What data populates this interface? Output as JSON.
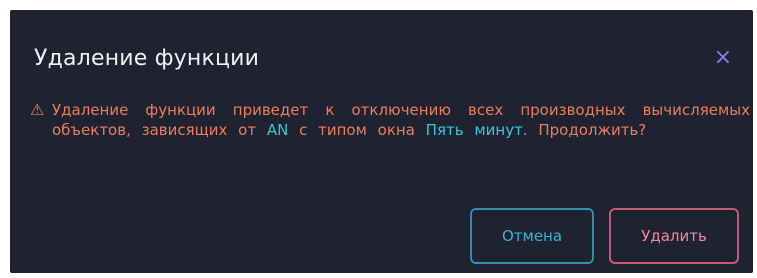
{
  "dialog": {
    "title": "Удаление функции",
    "close_icon": "×",
    "warning_icon": "⚠",
    "message_part1": "Удаление функции приведет к отключению всех производных вычисляемых объектов, зависящих от ",
    "object_name": "AN",
    "message_part2": " с типом окна ",
    "window_type": "Пять минут.",
    "message_part3": " Продолжить?",
    "cancel_label": "Отмена",
    "delete_label": "Удалить"
  },
  "colors": {
    "background": "#1f2230",
    "title": "#eef0f4",
    "warning": "#ec7d5c",
    "highlight": "#37c7d9",
    "close": "#8a7cf0",
    "cancel": "#3bb3d6",
    "delete": "#ef8aa0"
  }
}
